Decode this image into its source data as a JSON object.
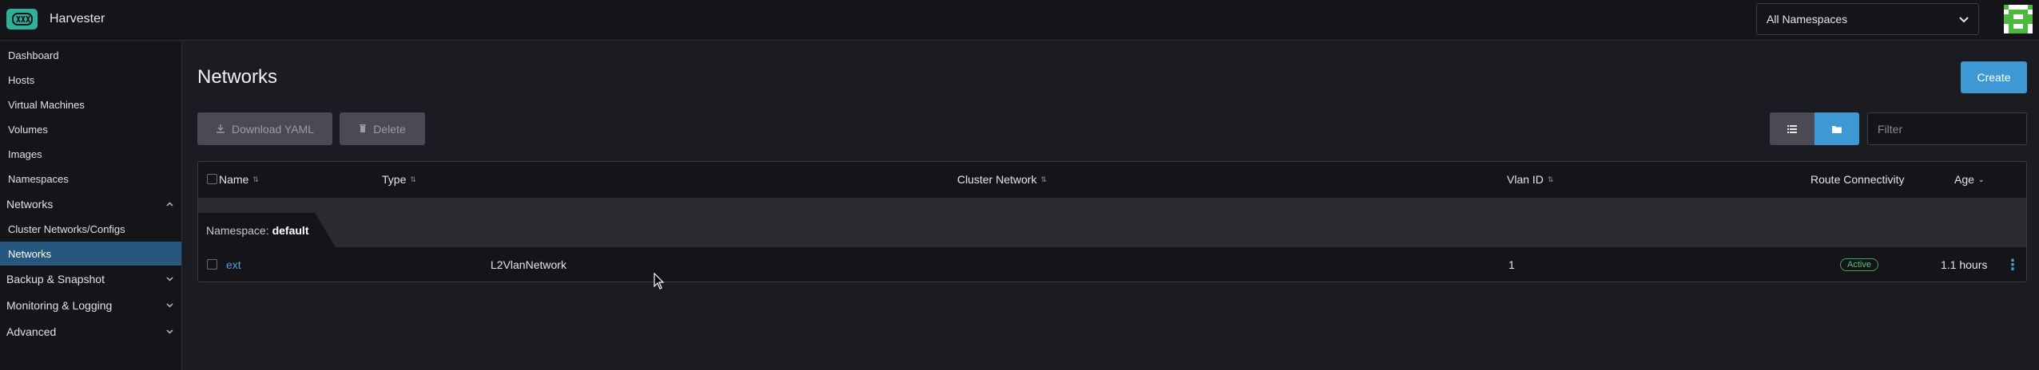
{
  "header": {
    "app_title": "Harvester",
    "namespace_select": "All Namespaces"
  },
  "sidebar": {
    "items": [
      {
        "label": "Dashboard"
      },
      {
        "label": "Hosts"
      },
      {
        "label": "Virtual Machines"
      },
      {
        "label": "Volumes"
      },
      {
        "label": "Images"
      },
      {
        "label": "Namespaces"
      },
      {
        "label": "Networks",
        "group": true,
        "expanded": true
      },
      {
        "label": "Cluster Networks/Configs"
      },
      {
        "label": "Networks",
        "active": true
      },
      {
        "label": "Backup & Snapshot",
        "group": true
      },
      {
        "label": "Monitoring & Logging",
        "group": true
      },
      {
        "label": "Advanced",
        "group": true
      }
    ]
  },
  "main": {
    "title": "Networks",
    "create_label": "Create",
    "download_label": "Download YAML",
    "delete_label": "Delete",
    "filter_placeholder": "Filter"
  },
  "table": {
    "columns": [
      "Name",
      "Type",
      "Cluster Network",
      "Vlan ID",
      "Route Connectivity",
      "Age"
    ],
    "group_label": "Namespace:",
    "group_value": "default",
    "rows": [
      {
        "name": "ext",
        "type": "L2VlanNetwork",
        "cluster_network": "",
        "vlan_id": "1",
        "route_connectivity": "Active",
        "age": "1.1 hours"
      }
    ]
  },
  "colors": {
    "accent": "#3d98d3",
    "logo": "#2eb09a",
    "active_nav": "#26577e",
    "status_active": "#5dc27b"
  }
}
